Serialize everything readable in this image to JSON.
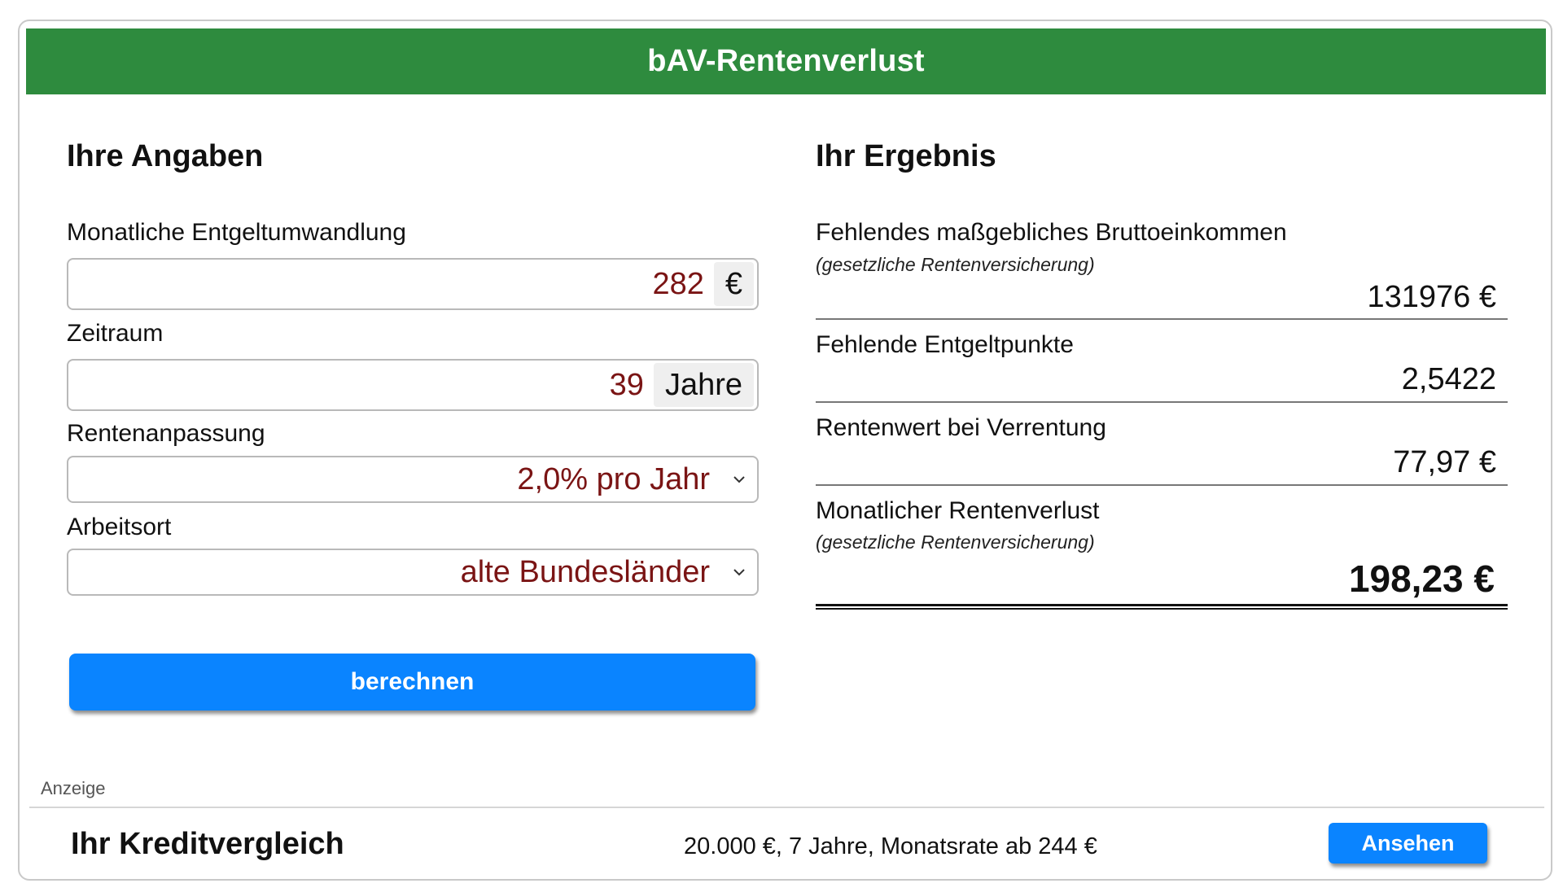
{
  "header": {
    "title": "bAV-Rentenverlust"
  },
  "inputs": {
    "section_title": "Ihre Angaben",
    "conversion": {
      "label": "Monatliche Entgeltumwandlung",
      "value": "282",
      "unit": "€"
    },
    "period": {
      "label": "Zeitraum",
      "value": "39",
      "unit": "Jahre"
    },
    "adjustment": {
      "label": "Rentenanpassung",
      "selected": "2,0% pro Jahr"
    },
    "workplace": {
      "label": "Arbeitsort",
      "selected": "alte Bundesländer"
    },
    "calculate_label": "berechnen"
  },
  "results": {
    "section_title": "Ihr Ergebnis",
    "gross_income": {
      "label": "Fehlendes maßgebliches Bruttoeinkommen",
      "note": "(gesetzliche Rentenversicherung)",
      "value": "131976 €"
    },
    "points": {
      "label": "Fehlende Entgeltpunkte",
      "value": "2,5422"
    },
    "pension_value": {
      "label": "Rentenwert bei Verrentung",
      "value": "77,97 €"
    },
    "monthly_loss": {
      "label": "Monatlicher Rentenverlust",
      "note": "(gesetzliche Rentenversicherung)",
      "value": "198,23 €"
    }
  },
  "ad": {
    "label": "Anzeige",
    "title": "Ihr Kreditvergleich",
    "text": "20.000 €, 7 Jahre, Monatsrate ab 244 €",
    "button_label": "Ansehen"
  },
  "colors": {
    "header": "#2e8b3e",
    "button": "#0a84ff",
    "input_value": "#7a1414"
  },
  "icons": {
    "select_arrow": "chevron-down-icon"
  }
}
